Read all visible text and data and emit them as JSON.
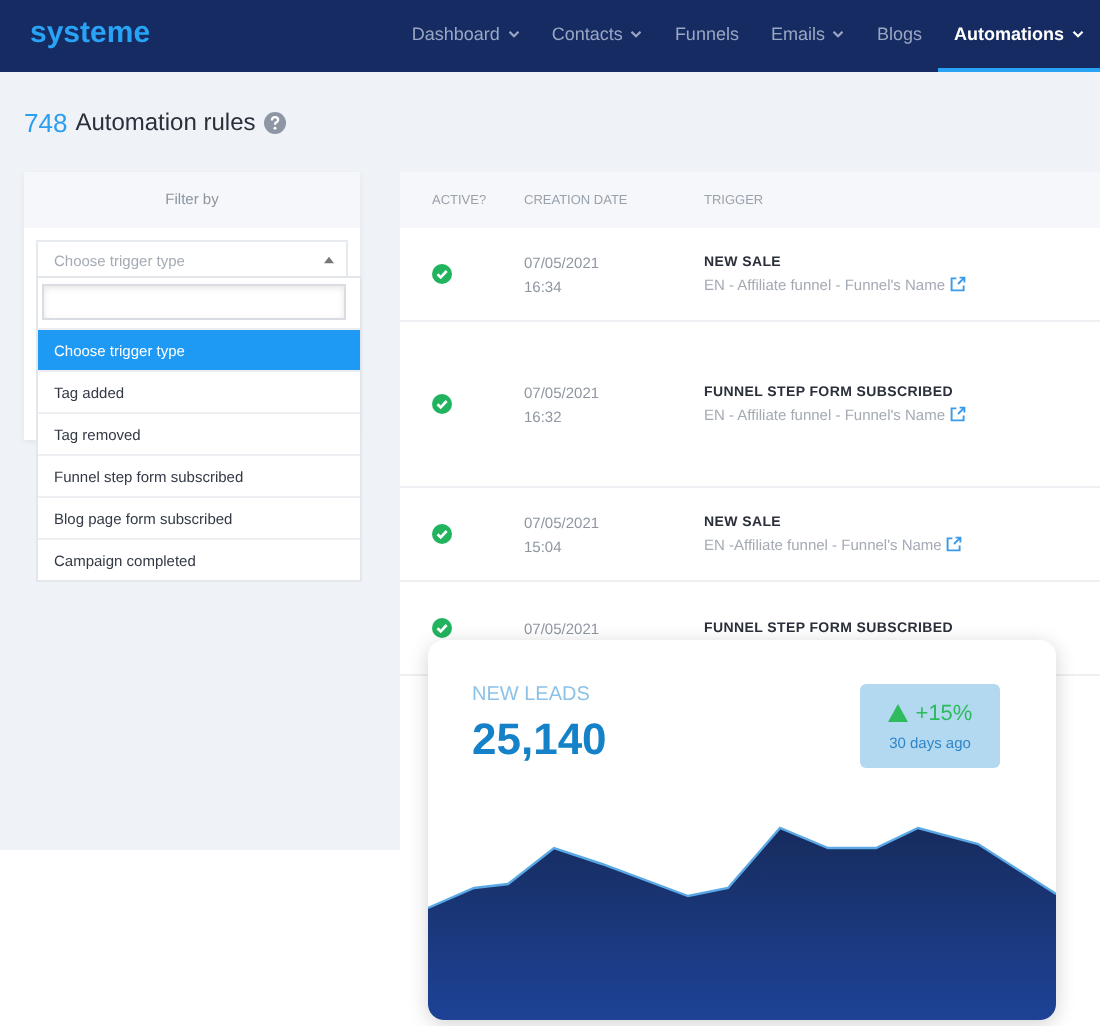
{
  "brand": "systeme",
  "nav": [
    {
      "label": "Dashboard",
      "has_menu": true,
      "selected": false
    },
    {
      "label": "Contacts",
      "has_menu": true,
      "selected": false
    },
    {
      "label": "Funnels",
      "has_menu": false,
      "selected": false
    },
    {
      "label": "Emails",
      "has_menu": true,
      "selected": false
    },
    {
      "label": "Blogs",
      "has_menu": false,
      "selected": false
    },
    {
      "label": "Automations",
      "has_menu": true,
      "selected": true
    }
  ],
  "heading": {
    "count": "748",
    "title": "Automation rules"
  },
  "filter": {
    "title": "Filter by",
    "select_placeholder": "Choose trigger type",
    "expanded": true,
    "options": [
      {
        "label": "Choose trigger type",
        "selected": true
      },
      {
        "label": "Tag added",
        "selected": false
      },
      {
        "label": "Tag removed",
        "selected": false
      },
      {
        "label": "Funnel step form subscribed",
        "selected": false
      },
      {
        "label": "Blog page form subscribed",
        "selected": false
      },
      {
        "label": "Campaign completed",
        "selected": false
      }
    ]
  },
  "table": {
    "columns": [
      "ACTIVE?",
      "CREATION DATE",
      "TRIGGER"
    ],
    "rows": [
      {
        "active": true,
        "date": "07/05/2021",
        "time": "16:34",
        "trigger": "NEW SALE",
        "detail": "EN - Affiliate funnel - Funnel's Name",
        "tall": false
      },
      {
        "active": true,
        "date": "07/05/2021",
        "time": "16:32",
        "trigger": "FUNNEL STEP FORM SUBSCRIBED",
        "detail": "EN - Affiliate funnel - Funnel's Name",
        "tall": true
      },
      {
        "active": true,
        "date": "07/05/2021",
        "time": "15:04",
        "trigger": "NEW SALE",
        "detail": "EN -Affiliate funnel - Funnel's Name",
        "tall": false
      },
      {
        "active": true,
        "date": "07/05/2021",
        "trigger": "FUNNEL STEP FORM SUBSCRIBED",
        "tall": false
      }
    ]
  },
  "leads_card": {
    "title": "NEW LEADS",
    "value": "25,140",
    "change": "+15%",
    "period": "30 days ago"
  }
}
